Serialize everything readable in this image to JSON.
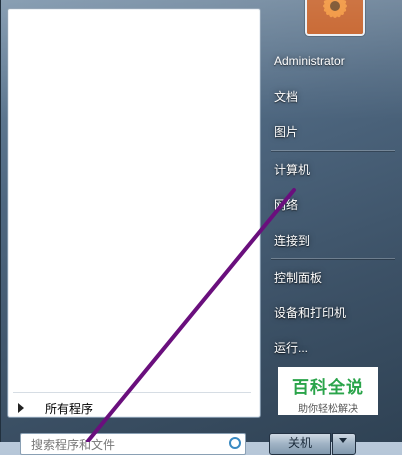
{
  "start_menu": {
    "all_programs_label": "所有程序",
    "search": {
      "placeholder": "搜索程序和文件"
    },
    "user": {
      "name": "Administrator"
    },
    "right_items": [
      {
        "label": "文档"
      },
      {
        "label": "图片"
      },
      {
        "label": "计算机"
      },
      {
        "label": "网络"
      },
      {
        "label": "连接到"
      },
      {
        "label": "控制面板"
      },
      {
        "label": "设备和打印机"
      },
      {
        "label": "运行..."
      }
    ],
    "shutdown_label": "关机"
  },
  "watermark": {
    "title": "百科全说",
    "subtitle": "助你轻松解决"
  },
  "colors": {
    "annotation_line": "#6a0f7d",
    "watermark_green": "#2aa44a"
  }
}
